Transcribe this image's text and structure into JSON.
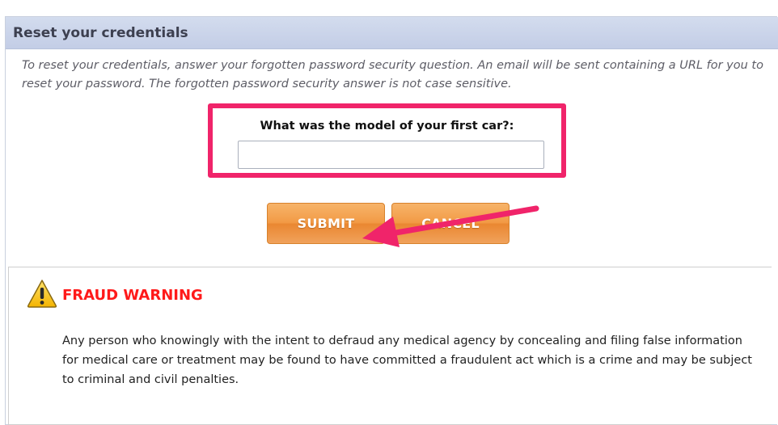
{
  "panel": {
    "title": "Reset your credentials",
    "intro": "To reset your credentials, answer your forgotten password security question. An email will be sent containing a URL for you to reset your password. The forgotten password security answer is not case sensitive."
  },
  "question": {
    "label": "What was the model of your first car?:",
    "answer_value": "",
    "highlight_color": "#f0246a"
  },
  "buttons": {
    "submit_label": "SUBMIT",
    "cancel_label": "CANCEL",
    "color": "#f29a45"
  },
  "warning": {
    "icon": "warning-triangle-icon",
    "title": "FRAUD WARNING",
    "text": "Any person who knowingly with the intent to defraud any medical agency by concealing and filing false information for medical care or treatment may be found to have committed a fraudulent act which is a crime and may be subject to criminal and civil penalties.",
    "title_color": "#ff1a1a"
  }
}
